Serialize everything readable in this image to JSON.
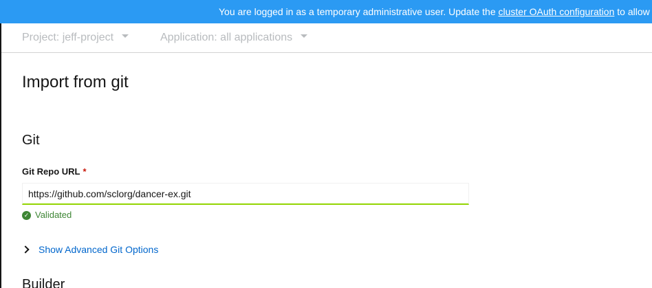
{
  "banner": {
    "text_before": "You are logged in as a temporary administrative user. Update the ",
    "link_text": "cluster OAuth configuration",
    "text_after": " to allow"
  },
  "context": {
    "project_label": "Project: jeff-project",
    "application_label": "Application: all applications"
  },
  "page": {
    "title": "Import from git"
  },
  "git": {
    "section_title": "Git",
    "repo_url_label": "Git Repo URL",
    "required_marker": "*",
    "repo_url_value": "https://github.com/sclorg/dancer-ex.git",
    "validation_text": "Validated",
    "advanced_toggle_label": "Show Advanced Git Options"
  },
  "builder": {
    "section_title": "Builder"
  },
  "icons": {
    "validated": "check-circle-icon",
    "advanced_toggle": "chevron-right-icon",
    "dropdown": "caret-down-icon"
  },
  "colors": {
    "banner_bg": "#2b9af3",
    "link": "#0066cc",
    "success": "#3e8635",
    "input_valid_underline": "#92d400",
    "required": "#c9190b"
  }
}
